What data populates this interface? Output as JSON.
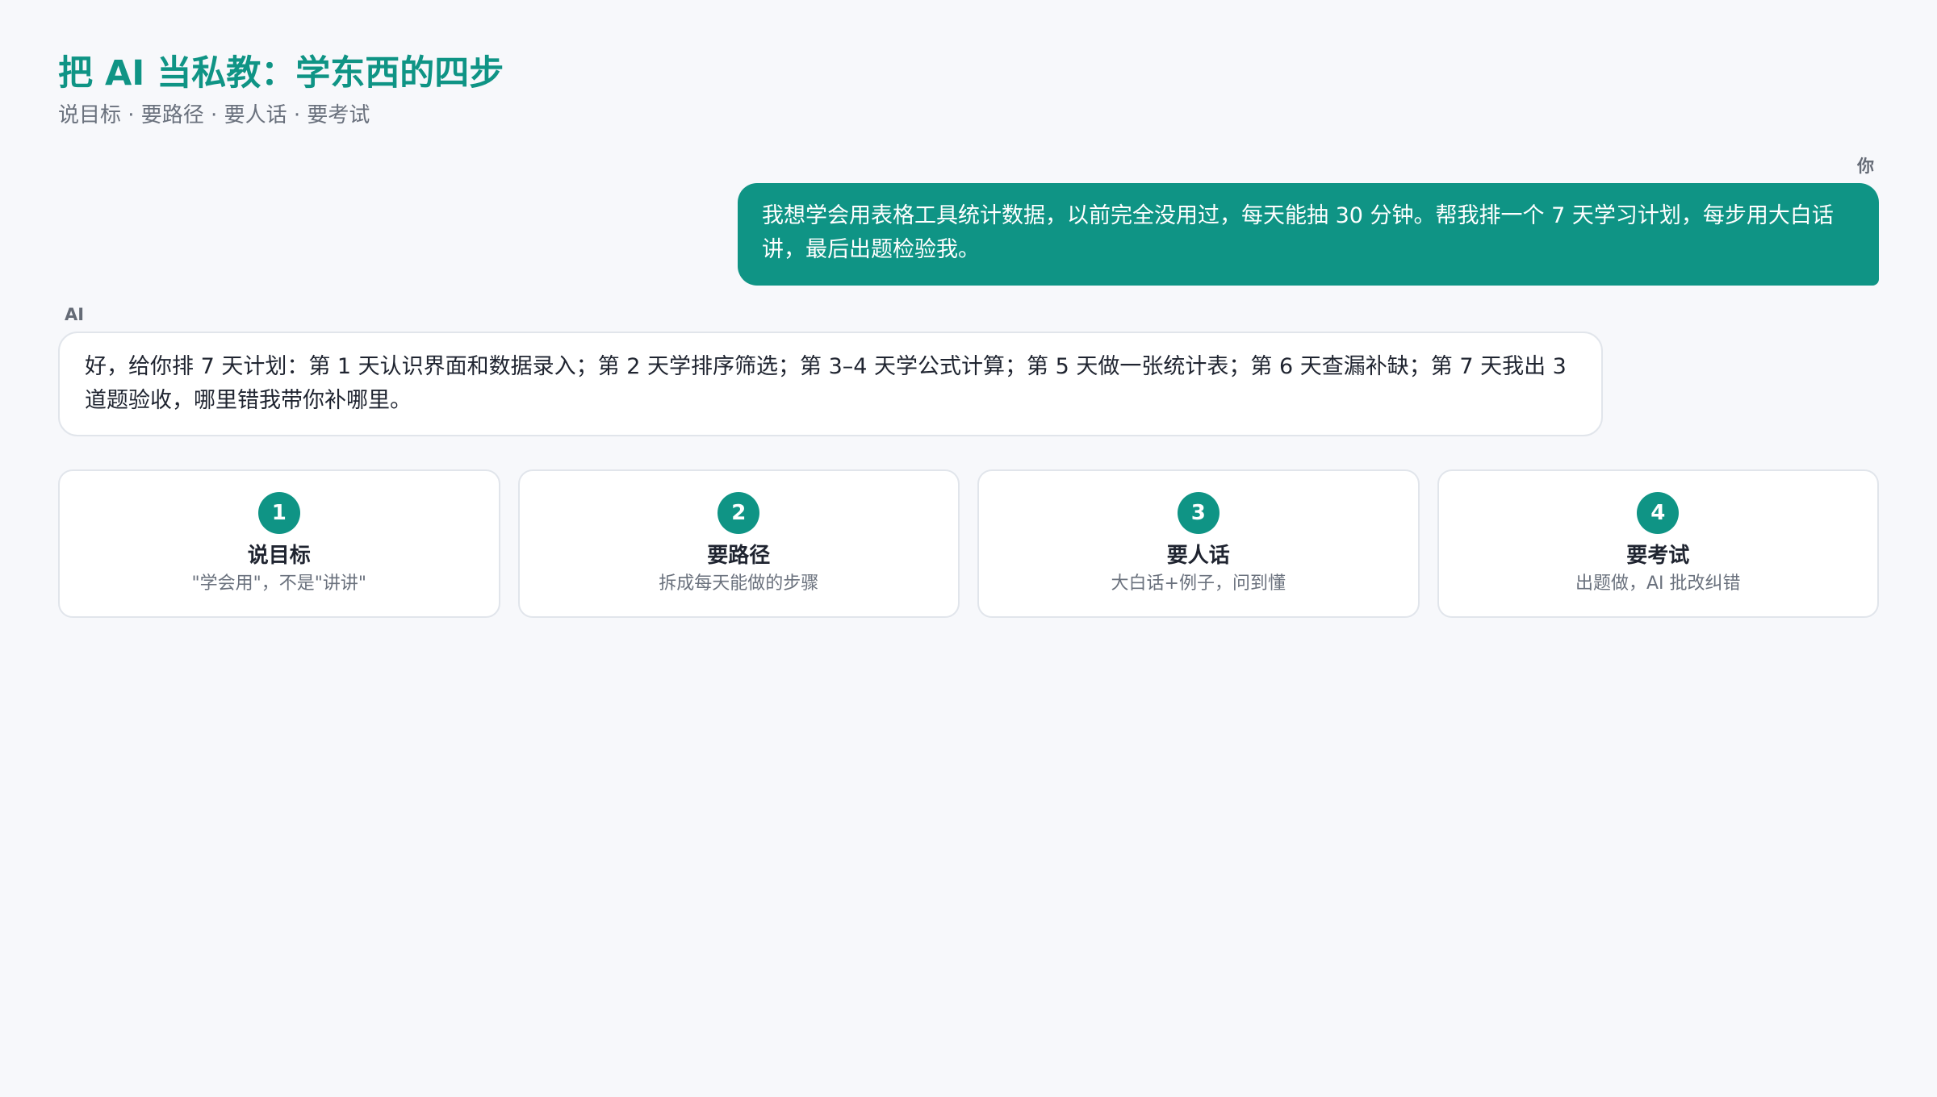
{
  "page": {
    "title": "把 AI 当私教：学东西的四步",
    "subtitle": "说目标 · 要路径 · 要人话 · 要考试"
  },
  "chat": {
    "user_label": "你",
    "user_message": "我想学会用表格工具统计数据，以前完全没用过，每天能抽 30 分钟。帮我排一个 7 天学习计划，每步用大白话讲，最后出题检验我。",
    "ai_label": "AI",
    "ai_message": "好，给你排 7 天计划：第 1 天认识界面和数据录入；第 2 天学排序筛选；第 3–4 天学公式计算；第 5 天做一张统计表；第 6 天查漏补缺；第 7 天我出 3 道题验收，哪里错我带你补哪里。"
  },
  "steps": [
    {
      "number": "1",
      "title": "说目标",
      "description": "\"学会用\"，不是\"讲讲\""
    },
    {
      "number": "2",
      "title": "要路径",
      "description": "拆成每天能做的步骤"
    },
    {
      "number": "3",
      "title": "要人话",
      "description": "大白话+例子，问到懂"
    },
    {
      "number": "4",
      "title": "要考试",
      "description": "出题做，AI 批改纠错"
    }
  ],
  "colors": {
    "accent": "#0f9485",
    "background": "#f7f8fb",
    "text": "#1f2430",
    "muted": "#6a717d",
    "border": "#e1e5eb"
  }
}
